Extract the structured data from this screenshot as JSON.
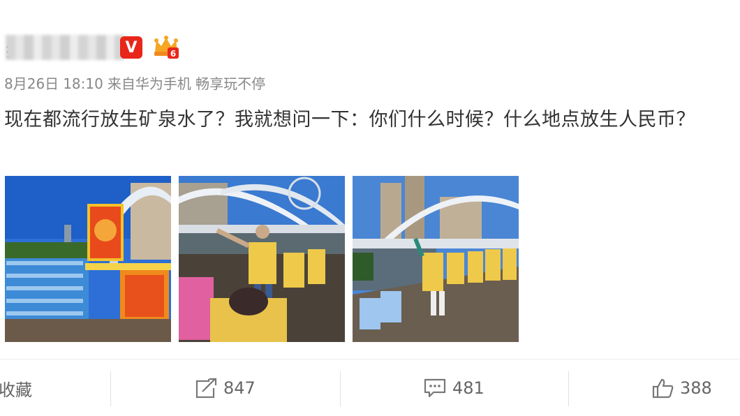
{
  "post": {
    "author_initial": "扌",
    "vip_badge": "V",
    "level_badge": "6",
    "meta": {
      "date": "8月26日",
      "time": "18:10",
      "source": "来自华为手机 畅享玩不停"
    },
    "text": "现在都流行放生矿泉水了？我就想问一下：你们什么时候？什么地点放生人民币？"
  },
  "photos": [
    {
      "name": "photo-altar-water-bottles"
    },
    {
      "name": "photo-woman-pointing-bridge"
    },
    {
      "name": "photo-group-riverbank"
    }
  ],
  "actions": {
    "collect_label": "收藏",
    "repost_count": "847",
    "comment_count": "481",
    "like_count": "388"
  },
  "colors": {
    "vip_badge": "#e8261a",
    "text": "#333333",
    "meta": "#888888"
  },
  "icons": [
    "repost-icon",
    "comment-icon",
    "like-icon",
    "crown-level-icon"
  ]
}
